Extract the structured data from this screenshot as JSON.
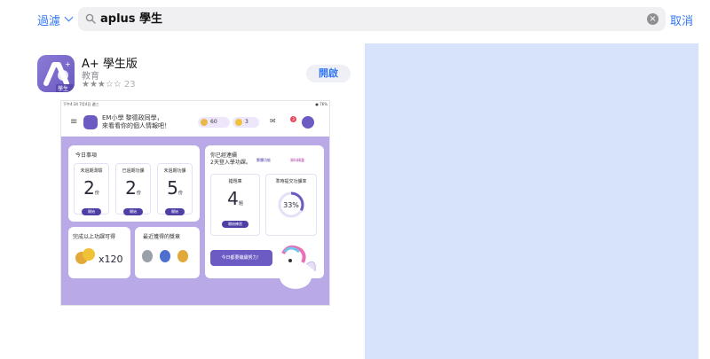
{
  "search": {
    "filter_label": "過濾",
    "query": "aplus 學生",
    "cancel_label": "取消"
  },
  "app": {
    "name": "A+ 學生版",
    "category": "教育",
    "stars": "★★★☆☆",
    "rating_count": "23",
    "get_label": "開啟",
    "icon_tag": "學生版"
  },
  "screenshot": {
    "status_left": "下午4:34 7月4日 週三",
    "status_right": "● 76%",
    "greeting_line1": "EM小學 黎德政同學，",
    "greeting_line2": "來看看你的個人情報吧！",
    "coins": "60",
    "gems": "3",
    "badge": "3",
    "today_title": "今日事項",
    "columns": [
      {
        "label": "未過期測驗",
        "value": "2",
        "unit": "份",
        "action": "開始"
      },
      {
        "label": "已過期功課",
        "value": "2",
        "unit": "份",
        "action": "開始"
      },
      {
        "label": "未過期功課",
        "value": "5",
        "unit": "份",
        "action": "開始"
      }
    ],
    "reward_title": "完成以上功課可得",
    "reward_amount": "x120",
    "recent_title": "最近獲得的獎章",
    "streak_title": "你已經連續",
    "streak_text": "2天登入學功課。",
    "tag1": "繁體功能",
    "tag2": "資料精靈",
    "wrong_title": "錯題庫",
    "wrong_value": "4",
    "wrong_unit": "題",
    "wrong_action": "開始練習",
    "rate_title": "準時提交功課率",
    "rate_value": "33%",
    "bubble_text": "今日都要繼續努力！"
  },
  "colors": {
    "accent": "#3478f6",
    "brand": "#6d5bc4",
    "dashboard_bg": "#b9a9e6",
    "preview_bg": "#d6e3fa"
  }
}
